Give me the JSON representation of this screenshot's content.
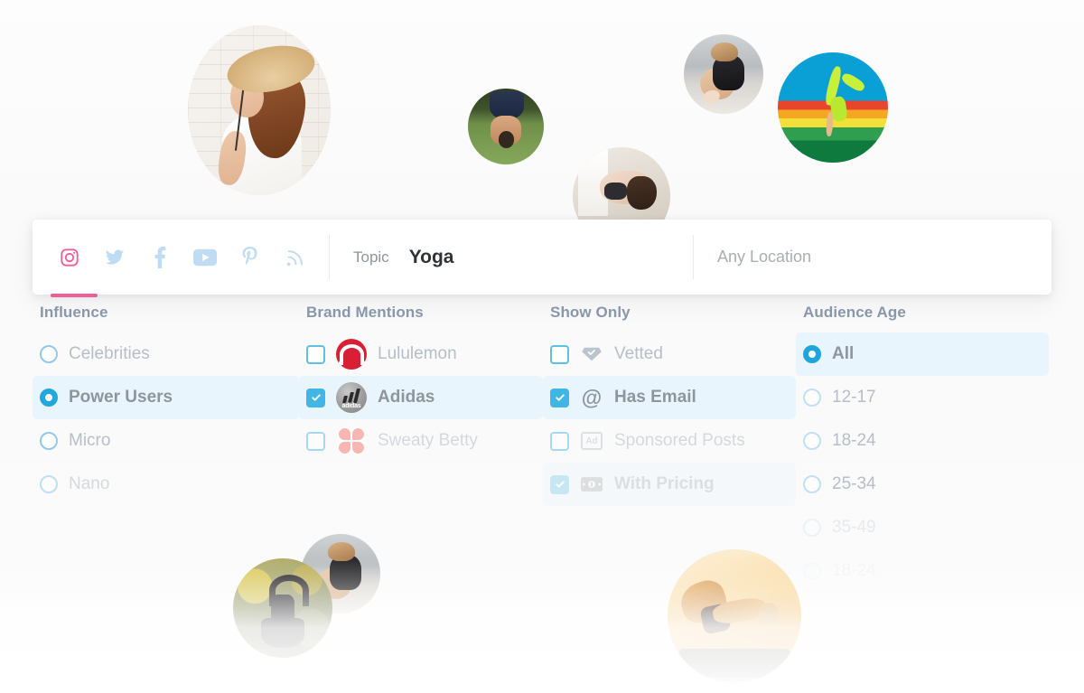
{
  "search": {
    "social_networks": [
      {
        "name": "instagram",
        "icon": "instagram-icon",
        "active": true
      },
      {
        "name": "twitter",
        "icon": "twitter-icon",
        "active": false
      },
      {
        "name": "facebook",
        "icon": "facebook-icon",
        "active": false
      },
      {
        "name": "youtube",
        "icon": "youtube-icon",
        "active": false
      },
      {
        "name": "pinterest",
        "icon": "pinterest-icon",
        "active": false
      },
      {
        "name": "blog",
        "icon": "rss-icon",
        "active": false
      }
    ],
    "topic_label": "Topic",
    "topic_value": "Yoga",
    "location_placeholder": "Any Location"
  },
  "filters": {
    "influence": {
      "title": "Influence",
      "control": "radio",
      "options": [
        {
          "label": "Celebrities",
          "selected": false
        },
        {
          "label": "Power Users",
          "selected": true
        },
        {
          "label": "Micro",
          "selected": false
        },
        {
          "label": "Nano",
          "selected": false
        }
      ]
    },
    "brand_mentions": {
      "title": "Brand Mentions",
      "control": "checkbox",
      "options": [
        {
          "label": "Lululemon",
          "checked": false,
          "logo": "lululemon-logo"
        },
        {
          "label": "Adidas",
          "checked": true,
          "logo": "adidas-logo"
        },
        {
          "label": "Sweaty Betty",
          "checked": false,
          "logo": "sweaty-betty-logo"
        }
      ]
    },
    "show_only": {
      "title": "Show Only",
      "control": "checkbox",
      "options": [
        {
          "label": "Vetted",
          "checked": false,
          "icon": "diamond-icon"
        },
        {
          "label": "Has Email",
          "checked": true,
          "icon": "at-icon"
        },
        {
          "label": "Sponsored Posts",
          "checked": false,
          "icon": "ad-icon"
        },
        {
          "label": "With Pricing",
          "checked": true,
          "icon": "money-icon"
        }
      ]
    },
    "audience_age": {
      "title": "Audience Age",
      "control": "radio",
      "options": [
        {
          "label": "All",
          "selected": true
        },
        {
          "label": "12-17",
          "selected": false
        },
        {
          "label": "18-24",
          "selected": false
        },
        {
          "label": "25-34",
          "selected": false
        },
        {
          "label": "35-49",
          "selected": false
        },
        {
          "label": "18-24",
          "selected": false
        }
      ]
    }
  },
  "colors": {
    "accent_blue": "#3fb6e3",
    "accent_pink": "#ec5f97",
    "selected_row_bg": "#e9f5fc",
    "label_grey": "#b6bec7",
    "title_grey": "#8a99ad"
  }
}
